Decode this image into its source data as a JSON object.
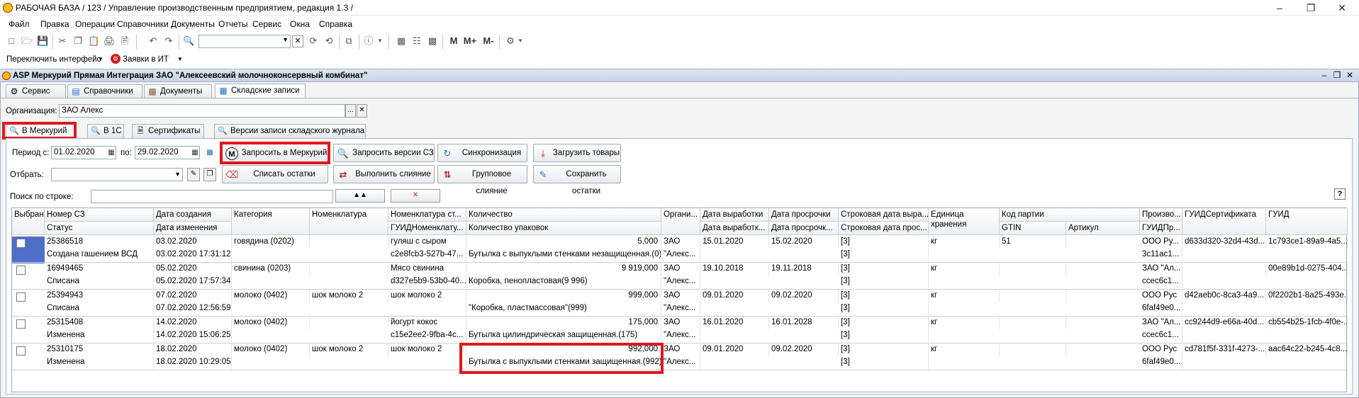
{
  "window": {
    "title": "РАБОЧАЯ БАЗА / 123 /  Управление производственным предприятием, редакция 1.3 /"
  },
  "menu": [
    "Файл",
    "Правка",
    "Операции",
    "Справочники",
    "Документы",
    "Отчеты",
    "Сервис",
    "Окна",
    "Справка"
  ],
  "toolbar2": {
    "switch_interface": "Переключить интерфейс",
    "it_requests": "Заявки в ИТ"
  },
  "inner_window": {
    "title": "ASP Меркурий Прямая Интеграция ЗАО \"Алексеевский молочноконсервный комбинат\""
  },
  "top_tabs": [
    "Сервис",
    "Справочники",
    "Документы",
    "Складские записи"
  ],
  "org": {
    "label": "Организация:",
    "value": "ЗАО  Алекс"
  },
  "sub_tabs": [
    "В Меркурий",
    "В 1С",
    "Сертификаты",
    "Версии записи складского журнала"
  ],
  "filters": {
    "period_label": "Период с:",
    "date_from": "01.02.2020",
    "po_label": "по:",
    "date_to": "29.02.2020",
    "select_label": "Отбрать:",
    "search_label": "Поиск по строке:"
  },
  "buttons": {
    "request_mercury": "Запросить в Меркурий",
    "request_versions": "Запросить версии СЗ",
    "sync": "Синхронизация",
    "load_goods": "Загрузить товары",
    "write_off": "Списать остатки",
    "merge": "Выполнить слияние",
    "group_merge": "Групповое слияние",
    "save_remains": "Сохранить остатки"
  },
  "table": {
    "headers_top": [
      "Выбран",
      "Номер СЗ",
      "Дата создания",
      "Категория",
      "Номенклатура",
      "Номенклатура ст...",
      "Количество",
      "Органи...",
      "Дата выработки",
      "Дата просрочки",
      "Строковая дата выра...",
      "Единица хранения",
      "Код партии",
      "Произво...",
      "ГУИДСертификата",
      "ГУИД"
    ],
    "headers_bottom": [
      "Статус",
      "Дата изменения",
      "ГУИДНоменклату...",
      "Количество упаковок",
      "Дата выработк...",
      "Дата просрочк...",
      "Строковая дата прос...",
      "GTIN",
      "Артикул",
      "ГУИДПр..."
    ],
    "rows": [
      {
        "num": "25386518",
        "created": "03.02.2020",
        "category": "говядина (0202)",
        "nomen": "",
        "nomen_st": "гуляш с сыром",
        "qty": "5,000",
        "org1": "ЗАО",
        "org2": "\"Алекс...",
        "prod_date": "15.01.2020",
        "exp_date": "15.02.2020",
        "str_prod": "[3]",
        "unit": "кг",
        "batch": "51",
        "producer": "ООО Ру...",
        "cert_guid": "d633d320-32d4-43d...",
        "guid": "1c793ce1-89a9-4a5...",
        "status": "Создана гашением ВСД",
        "changed": "03.02.2020 17:31:12",
        "guid_nom": "c2e8fcb3-527b-47...",
        "pack": "Бутылка с выпуклыми стенками незащищенная.(0)",
        "str_exp": "[3]",
        "guid_prod": "3c11ac1..."
      },
      {
        "num": "16949465",
        "created": "05.02.2020",
        "category": "свинина (0203)",
        "nomen": "",
        "nomen_st": "Мясо свинина",
        "qty": "9 919,000",
        "org1": "ЗАО",
        "org2": "\"Алекс...",
        "prod_date": "19.10.2018",
        "exp_date": "19.11.2018",
        "str_prod": "[3]",
        "unit": "кг",
        "batch": "",
        "producer": "ЗАО \"Ал...",
        "cert_guid": "",
        "guid": "00e89b1d-0275-404...",
        "status": "Списана",
        "changed": "05.02.2020 17:57:34",
        "guid_nom": "d327e5b9-53b0-40...",
        "pack": "Коробка, пенопластовая(9 996)",
        "str_exp": "[3]",
        "guid_prod": "ccec6c1..."
      },
      {
        "num": "25394943",
        "created": "07.02.2020",
        "category": "молоко (0402)",
        "nomen": "шок молоко 2",
        "nomen_st": "шок молоко 2",
        "qty": "999,000",
        "org1": "ЗАО",
        "org2": "\"Алекс...",
        "prod_date": "09.01.2020",
        "exp_date": "09.02.2020",
        "str_prod": "[3]",
        "unit": "кг",
        "batch": "",
        "producer": "ООО Рус",
        "cert_guid": "d42aeb0c-8ca3-4a9...",
        "guid": "0f2202b1-8a25-493e...",
        "status": "Списана",
        "changed": "07.02.2020 12:56:59",
        "guid_nom": "",
        "pack": "\"Коробка, пластмассовая\"(999)",
        "str_exp": "[3]",
        "guid_prod": "6faf49e0..."
      },
      {
        "num": "25315408",
        "created": "14.02.2020",
        "category": "молоко (0402)",
        "nomen": "",
        "nomen_st": "йогурт кокос",
        "qty": "175,000",
        "org1": "ЗАО",
        "org2": "\"Алекс...",
        "prod_date": "16.01.2020",
        "exp_date": "16.01.2028",
        "str_prod": "[3]",
        "unit": "кг",
        "batch": "",
        "producer": "ЗАО \"Ал...",
        "cert_guid": "cc9244d9-e66a-40d...",
        "guid": "cb554b25-1fcb-4f0e-...",
        "status": "Изменена",
        "changed": "14.02.2020 15:06:25",
        "guid_nom": "c15e2ee2-9fba-4c...",
        "pack": "Бутылка цилиндрическая защищенная.(175)",
        "str_exp": "[3]",
        "guid_prod": "ccec6c1..."
      },
      {
        "num": "25310175",
        "created": "18.02.2020",
        "category": "молоко (0402)",
        "nomen": "шок молоко 2",
        "nomen_st": "шок молоко 2",
        "qty": "992,000",
        "org1": "ЗАО",
        "org2": "\"Алекс...",
        "prod_date": "09.01.2020",
        "exp_date": "09.02.2020",
        "str_prod": "[3]",
        "unit": "кг",
        "batch": "",
        "producer": "ООО Рус",
        "cert_guid": "cd781f5f-331f-4273-...",
        "guid": "aac64c22-b245-4c8...",
        "status": "Изменена",
        "changed": "18.02.2020 10:29:05",
        "guid_nom": "",
        "pack": "Бутылка с выпуклыми стенками защищенная.(992)",
        "str_exp": "[3]",
        "guid_prod": "6faf49e0..."
      }
    ]
  },
  "colors": {
    "highlight_red": "#e0181c",
    "selection_blue": "#4f6fca"
  }
}
